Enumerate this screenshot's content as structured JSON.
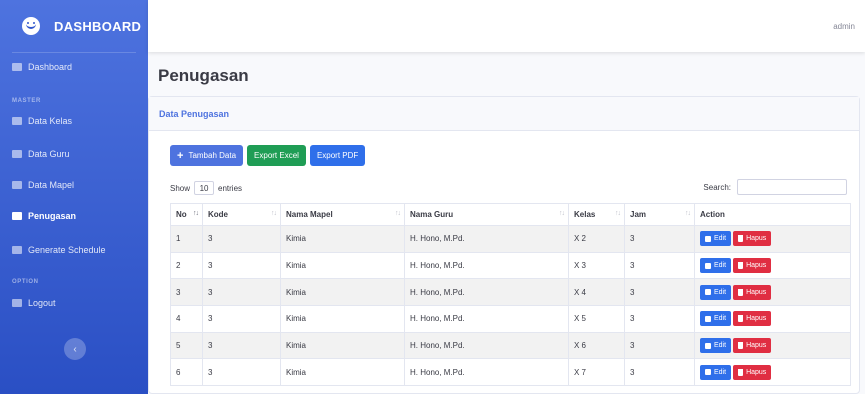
{
  "brand": "DASHBOARD",
  "user": "admin",
  "sidebar": {
    "dashboard": "Dashboard",
    "section_master": "MASTER",
    "data_kelas": "Data Kelas",
    "data_guru": "Data Guru",
    "data_mapel": "Data Mapel",
    "penugasan": "Penugasan",
    "generate": "Generate Schedule",
    "section_option": "OPTION",
    "logout": "Logout",
    "toggle": "‹"
  },
  "page_title": "Penugasan",
  "card_title": "Data Penugasan",
  "buttons": {
    "tambah": "Tambah Data",
    "excel": "Export Excel",
    "pdf": "Export PDF"
  },
  "length": {
    "show": "Show",
    "value": "10",
    "entries": "entries"
  },
  "search_label": "Search:",
  "columns": [
    "No",
    "Kode",
    "Nama Mapel",
    "Nama Guru",
    "Kelas",
    "Jam",
    "Action"
  ],
  "rows": [
    {
      "no": "1",
      "kode": "3",
      "mapel": "Kimia",
      "guru": "H. Hono, M.Pd.",
      "kelas": "X 2",
      "jam": "3"
    },
    {
      "no": "2",
      "kode": "3",
      "mapel": "Kimia",
      "guru": "H. Hono, M.Pd.",
      "kelas": "X 3",
      "jam": "3"
    },
    {
      "no": "3",
      "kode": "3",
      "mapel": "Kimia",
      "guru": "H. Hono, M.Pd.",
      "kelas": "X 4",
      "jam": "3"
    },
    {
      "no": "4",
      "kode": "3",
      "mapel": "Kimia",
      "guru": "H. Hono, M.Pd.",
      "kelas": "X 5",
      "jam": "3"
    },
    {
      "no": "5",
      "kode": "3",
      "mapel": "Kimia",
      "guru": "H. Hono, M.Pd.",
      "kelas": "X 6",
      "jam": "3"
    },
    {
      "no": "6",
      "kode": "3",
      "mapel": "Kimia",
      "guru": "H. Hono, M.Pd.",
      "kelas": "X 7",
      "jam": "3"
    }
  ],
  "actions": {
    "edit": "Edit",
    "hapus": "Hapus"
  }
}
